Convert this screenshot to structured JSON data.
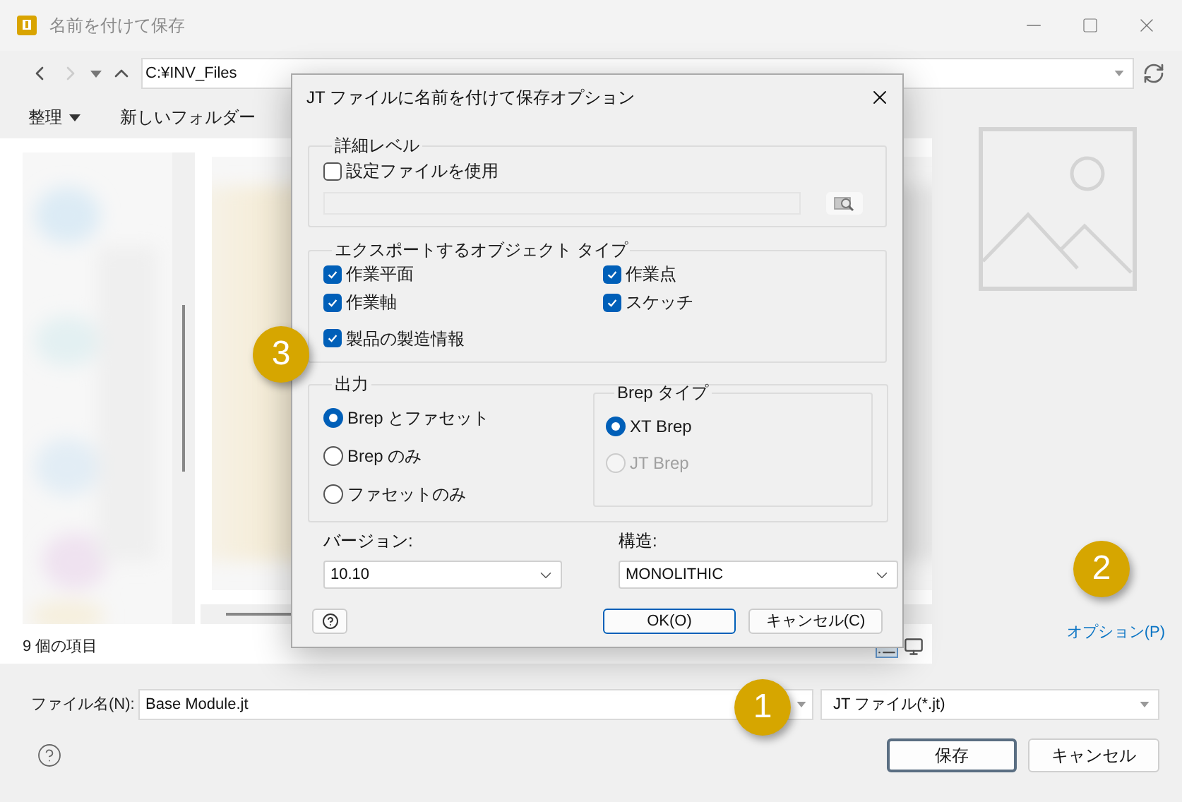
{
  "window": {
    "title": "名前を付けて保存"
  },
  "address_bar": {
    "path": "C:¥INV_Files"
  },
  "toolbar": {
    "organize": "整理",
    "new_folder": "新しいフォルダー"
  },
  "status_bar": {
    "item_count": "9 個の項目"
  },
  "options_link": "オプション(P)",
  "file_name": {
    "label": "ファイル名(N):",
    "value": "Base Module.jt"
  },
  "file_type": {
    "value": "JT ファイル(*.jt)"
  },
  "buttons": [
    "保存",
    "キャンセル"
  ],
  "callouts": [
    "1",
    "2",
    "3"
  ],
  "options_dialog": {
    "title": "JT ファイルに名前を付けて保存オプション",
    "detail_level": {
      "label": "詳細レベル",
      "use_config_file": {
        "label": "設定ファイルを使用",
        "checked": false
      }
    },
    "object_types": {
      "label": "エクスポートするオブジェクト タイプ",
      "items": [
        {
          "label": "作業平面",
          "checked": true
        },
        {
          "label": "作業点",
          "checked": true
        },
        {
          "label": "作業軸",
          "checked": true
        },
        {
          "label": "スケッチ",
          "checked": true
        },
        {
          "label": "製品の製造情報",
          "checked": true
        }
      ]
    },
    "output": {
      "label": "出力",
      "options": [
        {
          "label": "Brep とファセット",
          "selected": true
        },
        {
          "label": "Brep のみ",
          "selected": false
        },
        {
          "label": "ファセットのみ",
          "selected": false
        }
      ],
      "brep_type": {
        "label": "Brep タイプ",
        "options": [
          {
            "label": "XT Brep",
            "selected": true,
            "disabled": false
          },
          {
            "label": "JT Brep",
            "selected": false,
            "disabled": true
          }
        ]
      }
    },
    "version": {
      "label": "バージョン:",
      "value": "10.10"
    },
    "structure": {
      "label": "構造:",
      "value": "MONOLITHIC"
    },
    "buttons": [
      "OK(O)",
      "キャンセル(C)"
    ]
  }
}
